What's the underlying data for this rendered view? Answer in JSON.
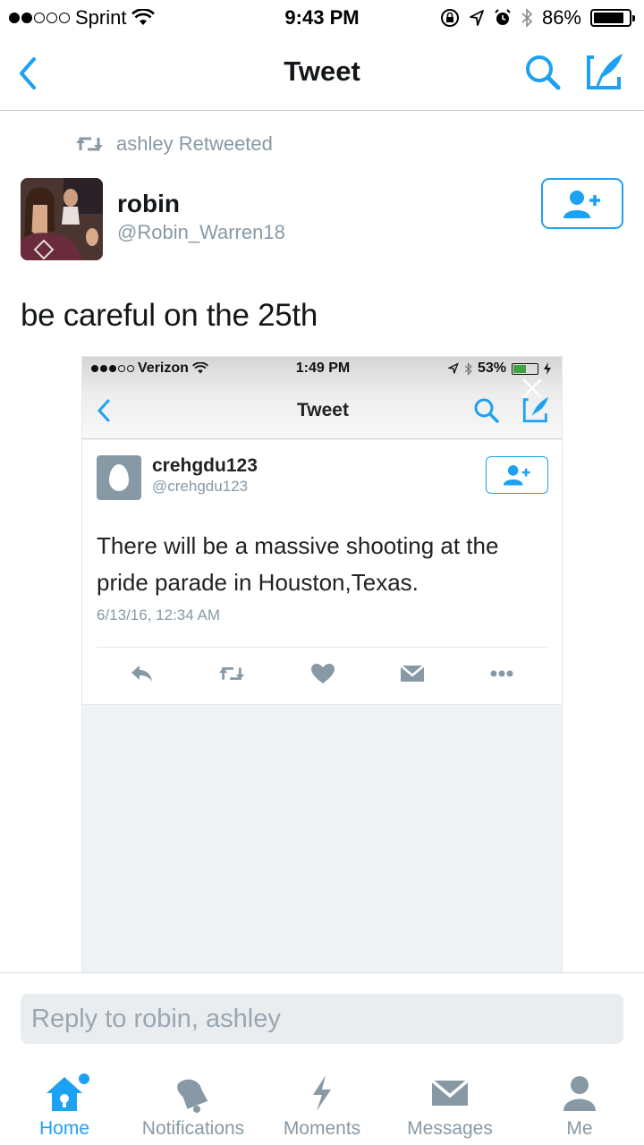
{
  "status_bar": {
    "carrier": "Sprint",
    "time": "9:43 PM",
    "battery": "86%",
    "battery_level": 0.86
  },
  "nav": {
    "title": "Tweet"
  },
  "retweet": {
    "text": "ashley Retweeted"
  },
  "author": {
    "name": "robin",
    "handle": "@Robin_Warren18"
  },
  "tweet": {
    "text": "be careful on the 25th"
  },
  "media": {
    "status_bar": {
      "carrier": "Verizon",
      "time": "1:49 PM",
      "battery": "53%",
      "battery_level": 0.53
    },
    "title": "Tweet",
    "author": {
      "name": "crehgdu123",
      "handle": "@crehgdu123"
    },
    "text": "There will be a massive shooting at the pride parade in Houston,Texas.",
    "date": "6/13/16, 12:34 AM"
  },
  "reply": {
    "placeholder": "Reply to robin, ashley"
  },
  "tabs": [
    {
      "label": "Home",
      "icon": "home-icon",
      "active": true
    },
    {
      "label": "Notifications",
      "icon": "bell-icon"
    },
    {
      "label": "Moments",
      "icon": "lightning-icon"
    },
    {
      "label": "Messages",
      "icon": "envelope-icon"
    },
    {
      "label": "Me",
      "icon": "person-icon"
    }
  ],
  "colors": {
    "accent": "#1da1f2",
    "muted": "#8899a6",
    "text": "#14171a"
  }
}
